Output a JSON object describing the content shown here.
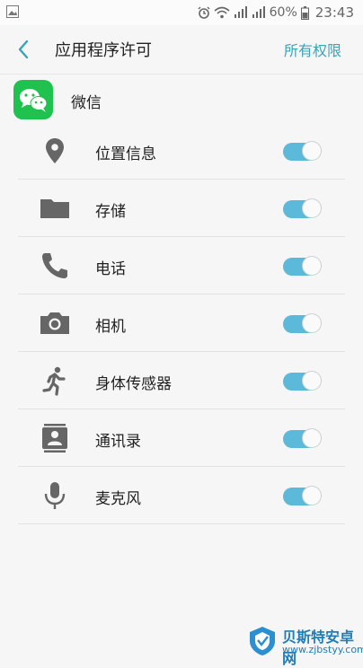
{
  "status_bar": {
    "battery": "60%",
    "time": "23:43"
  },
  "header": {
    "title": "应用程序许可",
    "action": "所有权限"
  },
  "app": {
    "name": "微信"
  },
  "permissions": [
    {
      "label": "位置信息",
      "icon": "location-pin-icon",
      "enabled": true
    },
    {
      "label": "存储",
      "icon": "folder-icon",
      "enabled": true
    },
    {
      "label": "电话",
      "icon": "phone-icon",
      "enabled": true
    },
    {
      "label": "相机",
      "icon": "camera-icon",
      "enabled": true
    },
    {
      "label": "身体传感器",
      "icon": "running-person-icon",
      "enabled": true
    },
    {
      "label": "通讯录",
      "icon": "contacts-icon",
      "enabled": true
    },
    {
      "label": "麦克风",
      "icon": "microphone-icon",
      "enabled": true
    }
  ],
  "watermark": {
    "title": "贝斯特安卓网",
    "url": "www.zjbstyy.com"
  },
  "colors": {
    "accent": "#3aa3b5",
    "toggle_on": "#5cb9da",
    "app_green": "#1fc24f"
  }
}
